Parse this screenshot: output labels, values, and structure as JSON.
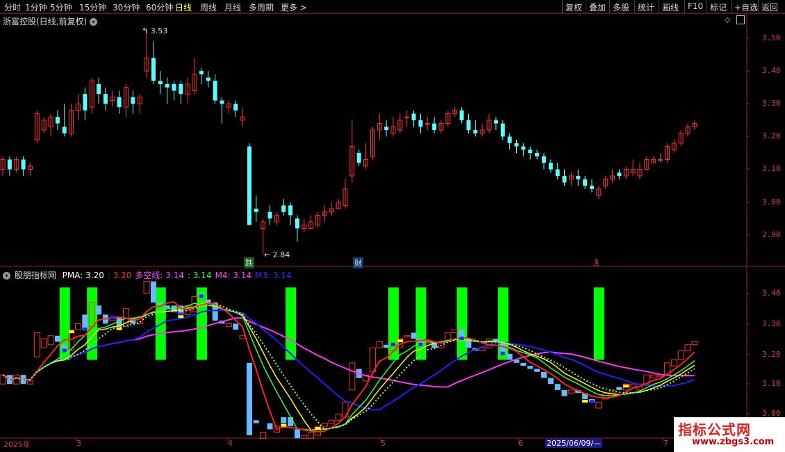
{
  "toolbar": {
    "periods": [
      "分时",
      "1分钟",
      "5分钟",
      "15分钟",
      "30分钟",
      "60分钟",
      "日线",
      "周线",
      "月线",
      "多周期",
      "更多 >"
    ],
    "active_period": "日线",
    "right_buttons": [
      "复权",
      "叠加",
      "多股",
      "统计",
      "画线",
      "F10",
      "标记",
      "+自选",
      "返回"
    ]
  },
  "main_panel": {
    "title": "浙富控股(日线,前复权)",
    "high_label": "3.53",
    "low_label": "2.84",
    "event_labels": [
      "跌",
      "财",
      "$"
    ],
    "price_ticks": [
      "3.50",
      "3.40",
      "3.30",
      "3.20",
      "3.10",
      "3.00",
      "2.90"
    ]
  },
  "indicator_panel": {
    "name": "股朋指标网",
    "legend": [
      {
        "label": "PMA: 3.20",
        "color": "#ffffff"
      },
      {
        "label": ": 3.20",
        "color": "#ff3030"
      },
      {
        "label": "多空线: 3.14",
        "color": "#ff44ff"
      },
      {
        "label": ": 3.14",
        "color": "#33ff33"
      },
      {
        "label": "M4: 3.14",
        "color": "#ff44ff"
      },
      {
        "label": "M3: 3.14",
        "color": "#3333ff"
      }
    ],
    "price_ticks": [
      "3.40",
      "3.30",
      "3.20",
      "3.10",
      "3.00"
    ]
  },
  "date_axis": {
    "labels": [
      "2025年",
      "3",
      "4",
      "5",
      "6",
      "7"
    ],
    "cursor_date": "2025/06/09/—"
  },
  "watermark": {
    "line1": "指标公式网",
    "line2": "www.zbgs3.com"
  },
  "colors": {
    "up": "#ff3030",
    "down": "#54ffff",
    "red_line": "#ff2020",
    "yellow_line": "#ffff00",
    "green_line": "#33ff33",
    "blue_line": "#2020ff",
    "magenta_line": "#ff33ff",
    "green_bar": "#00ff00"
  },
  "candles": [
    [
      3.1,
      3.13,
      3.08,
      3.14
    ],
    [
      3.13,
      3.1,
      3.08,
      3.14
    ],
    [
      3.1,
      3.13,
      3.09,
      3.14
    ],
    [
      3.13,
      3.1,
      3.08,
      3.14
    ],
    [
      3.1,
      3.11,
      3.08,
      3.12
    ],
    [
      3.19,
      3.27,
      3.18,
      3.28
    ],
    [
      3.22,
      3.25,
      3.21,
      3.26
    ],
    [
      3.23,
      3.26,
      3.2,
      3.27
    ],
    [
      3.26,
      3.24,
      3.22,
      3.28
    ],
    [
      3.23,
      3.21,
      3.2,
      3.3
    ],
    [
      3.21,
      3.28,
      3.2,
      3.3
    ],
    [
      3.28,
      3.3,
      3.25,
      3.33
    ],
    [
      3.33,
      3.28,
      3.25,
      3.35
    ],
    [
      3.29,
      3.37,
      3.27,
      3.38
    ],
    [
      3.36,
      3.33,
      3.3,
      3.38
    ],
    [
      3.33,
      3.3,
      3.28,
      3.35
    ],
    [
      3.31,
      3.32,
      3.29,
      3.34
    ],
    [
      3.32,
      3.29,
      3.27,
      3.34
    ],
    [
      3.29,
      3.35,
      3.26,
      3.36
    ],
    [
      3.32,
      3.3,
      3.27,
      3.34
    ],
    [
      3.3,
      3.32,
      3.27,
      3.33
    ],
    [
      3.4,
      3.44,
      3.38,
      3.53
    ],
    [
      3.44,
      3.37,
      3.36,
      3.49
    ],
    [
      3.37,
      3.36,
      3.33,
      3.4
    ],
    [
      3.36,
      3.35,
      3.3,
      3.38
    ],
    [
      3.36,
      3.34,
      3.31,
      3.37
    ],
    [
      3.36,
      3.33,
      3.3,
      3.37
    ],
    [
      3.33,
      3.36,
      3.3,
      3.38
    ],
    [
      3.34,
      3.39,
      3.33,
      3.44
    ],
    [
      3.4,
      3.39,
      3.36,
      3.41
    ],
    [
      3.38,
      3.37,
      3.35,
      3.4
    ],
    [
      3.37,
      3.31,
      3.3,
      3.39
    ],
    [
      3.31,
      3.3,
      3.24,
      3.32
    ],
    [
      3.29,
      3.3,
      3.27,
      3.31
    ],
    [
      3.3,
      3.28,
      3.26,
      3.31
    ],
    [
      3.25,
      3.26,
      3.23,
      3.29
    ],
    [
      3.17,
      2.93,
      2.93,
      3.18
    ],
    [
      2.98,
      2.97,
      2.94,
      3.02
    ],
    [
      2.92,
      2.94,
      2.84,
      2.95
    ],
    [
      2.97,
      2.95,
      2.93,
      2.99
    ],
    [
      2.94,
      2.96,
      2.93,
      2.97
    ],
    [
      2.99,
      2.97,
      2.96,
      3.01
    ],
    [
      2.99,
      2.96,
      2.93,
      3.0
    ],
    [
      2.95,
      2.92,
      2.88,
      2.96
    ],
    [
      2.92,
      2.93,
      2.91,
      2.95
    ],
    [
      2.92,
      2.94,
      2.92,
      2.96
    ],
    [
      2.93,
      2.96,
      2.92,
      2.97
    ],
    [
      2.96,
      2.97,
      2.94,
      2.99
    ],
    [
      2.97,
      2.98,
      2.96,
      3.0
    ],
    [
      2.98,
      3.0,
      2.98,
      3.01
    ],
    [
      2.99,
      3.04,
      2.98,
      3.07
    ],
    [
      3.08,
      3.17,
      3.06,
      3.25
    ],
    [
      3.15,
      3.12,
      3.11,
      3.16
    ],
    [
      3.11,
      3.13,
      3.1,
      3.18
    ],
    [
      3.14,
      3.22,
      3.13,
      3.23
    ],
    [
      3.22,
      3.24,
      3.19,
      3.27
    ],
    [
      3.23,
      3.22,
      3.2,
      3.25
    ],
    [
      3.21,
      3.23,
      3.2,
      3.26
    ],
    [
      3.22,
      3.25,
      3.21,
      3.27
    ],
    [
      3.26,
      3.26,
      3.23,
      3.28
    ],
    [
      3.27,
      3.25,
      3.23,
      3.28
    ],
    [
      3.25,
      3.23,
      3.21,
      3.27
    ],
    [
      3.24,
      3.24,
      3.22,
      3.26
    ],
    [
      3.24,
      3.22,
      3.21,
      3.26
    ],
    [
      3.22,
      3.24,
      3.21,
      3.25
    ],
    [
      3.24,
      3.27,
      3.23,
      3.28
    ],
    [
      3.27,
      3.28,
      3.26,
      3.29
    ],
    [
      3.28,
      3.25,
      3.24,
      3.29
    ],
    [
      3.25,
      3.22,
      3.21,
      3.27
    ],
    [
      3.22,
      3.21,
      3.2,
      3.25
    ],
    [
      3.21,
      3.22,
      3.2,
      3.24
    ],
    [
      3.22,
      3.25,
      3.21,
      3.27
    ],
    [
      3.25,
      3.24,
      3.22,
      3.26
    ],
    [
      3.24,
      3.2,
      3.19,
      3.25
    ],
    [
      3.2,
      3.18,
      3.16,
      3.21
    ],
    [
      3.18,
      3.17,
      3.15,
      3.19
    ],
    [
      3.17,
      3.16,
      3.14,
      3.18
    ],
    [
      3.16,
      3.15,
      3.13,
      3.17
    ],
    [
      3.15,
      3.14,
      3.13,
      3.16
    ],
    [
      3.14,
      3.12,
      3.1,
      3.15
    ],
    [
      3.12,
      3.1,
      3.09,
      3.13
    ],
    [
      3.1,
      3.08,
      3.07,
      3.12
    ],
    [
      3.08,
      3.06,
      3.05,
      3.1
    ],
    [
      3.07,
      3.08,
      3.05,
      3.09
    ],
    [
      3.08,
      3.07,
      3.05,
      3.1
    ],
    [
      3.07,
      3.05,
      3.04,
      3.08
    ],
    [
      3.05,
      3.04,
      3.03,
      3.07
    ],
    [
      3.02,
      3.04,
      3.01,
      3.05
    ],
    [
      3.05,
      3.07,
      3.04,
      3.08
    ],
    [
      3.07,
      3.08,
      3.06,
      3.1
    ],
    [
      3.09,
      3.08,
      3.07,
      3.1
    ],
    [
      3.08,
      3.1,
      3.07,
      3.11
    ],
    [
      3.09,
      3.1,
      3.08,
      3.13
    ],
    [
      3.08,
      3.1,
      3.07,
      3.12
    ],
    [
      3.1,
      3.13,
      3.1,
      3.14
    ],
    [
      3.12,
      3.13,
      3.12,
      3.14
    ],
    [
      3.13,
      3.13,
      3.12,
      3.15
    ],
    [
      3.13,
      3.17,
      3.12,
      3.18
    ],
    [
      3.16,
      3.18,
      3.15,
      3.19
    ],
    [
      3.18,
      3.21,
      3.17,
      3.22
    ],
    [
      3.21,
      3.23,
      3.2,
      3.24
    ],
    [
      3.23,
      3.24,
      3.22,
      3.25
    ]
  ]
}
